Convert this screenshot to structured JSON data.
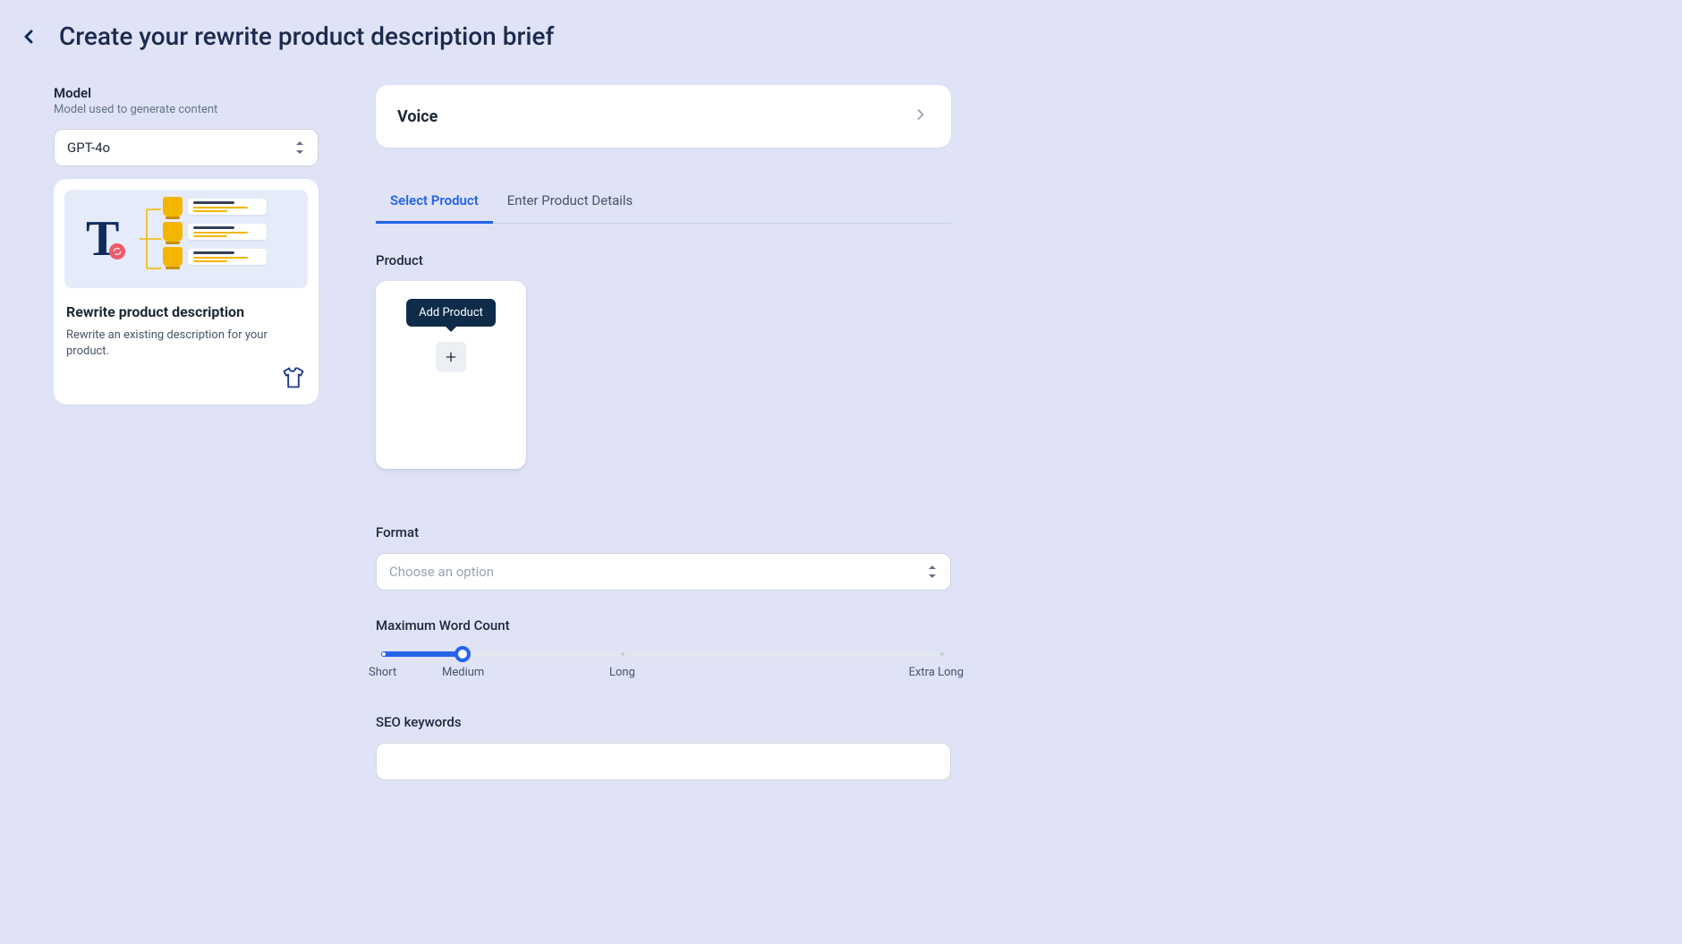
{
  "header": {
    "title": "Create your rewrite product description brief"
  },
  "model": {
    "label": "Model",
    "sublabel": "Model used to generate content",
    "selected": "GPT-4o"
  },
  "card": {
    "title": "Rewrite product description",
    "description": "Rewrite an existing description for your product."
  },
  "voice": {
    "label": "Voice"
  },
  "tabs": {
    "select_product": "Select Product",
    "enter_details": "Enter Product Details"
  },
  "product": {
    "label": "Product",
    "tooltip": "Add Product"
  },
  "format": {
    "label": "Format",
    "placeholder": "Choose an option"
  },
  "wordcount": {
    "label": "Maximum Word Count",
    "options": {
      "short": "Short",
      "medium": "Medium",
      "long": "Long",
      "extra_long": "Extra Long"
    }
  },
  "seo": {
    "label": "SEO keywords",
    "value": ""
  }
}
